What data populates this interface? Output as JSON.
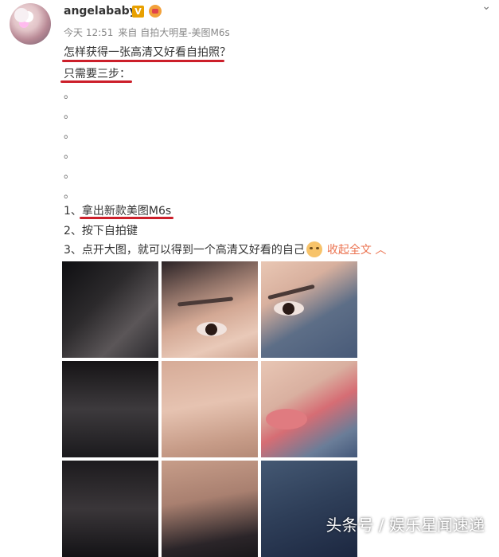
{
  "user": {
    "name": "angelababy",
    "badge": "V"
  },
  "meta": {
    "time": "今天 12:51",
    "source": "来自 自拍大明星-美图M6s"
  },
  "post": {
    "line1": "怎样获得一张高清又好看自拍照？",
    "line2": "只需要三步：",
    "dots": [
      "。",
      "。",
      "。",
      "。",
      "。",
      "。"
    ],
    "step1": "1、拿出新款美图M6s",
    "step2": "2、按下自拍键",
    "step3": "3、点开大图，就可以得到一个高清又好看的自己",
    "collapse": "收起全文",
    "collapse_icon": "chevron-up-icon"
  },
  "watermark": "头条号 / 娱乐星闻速递",
  "colors": {
    "underline": "#cc1f2a",
    "link": "#eb7350",
    "badge": "#e8a000"
  }
}
